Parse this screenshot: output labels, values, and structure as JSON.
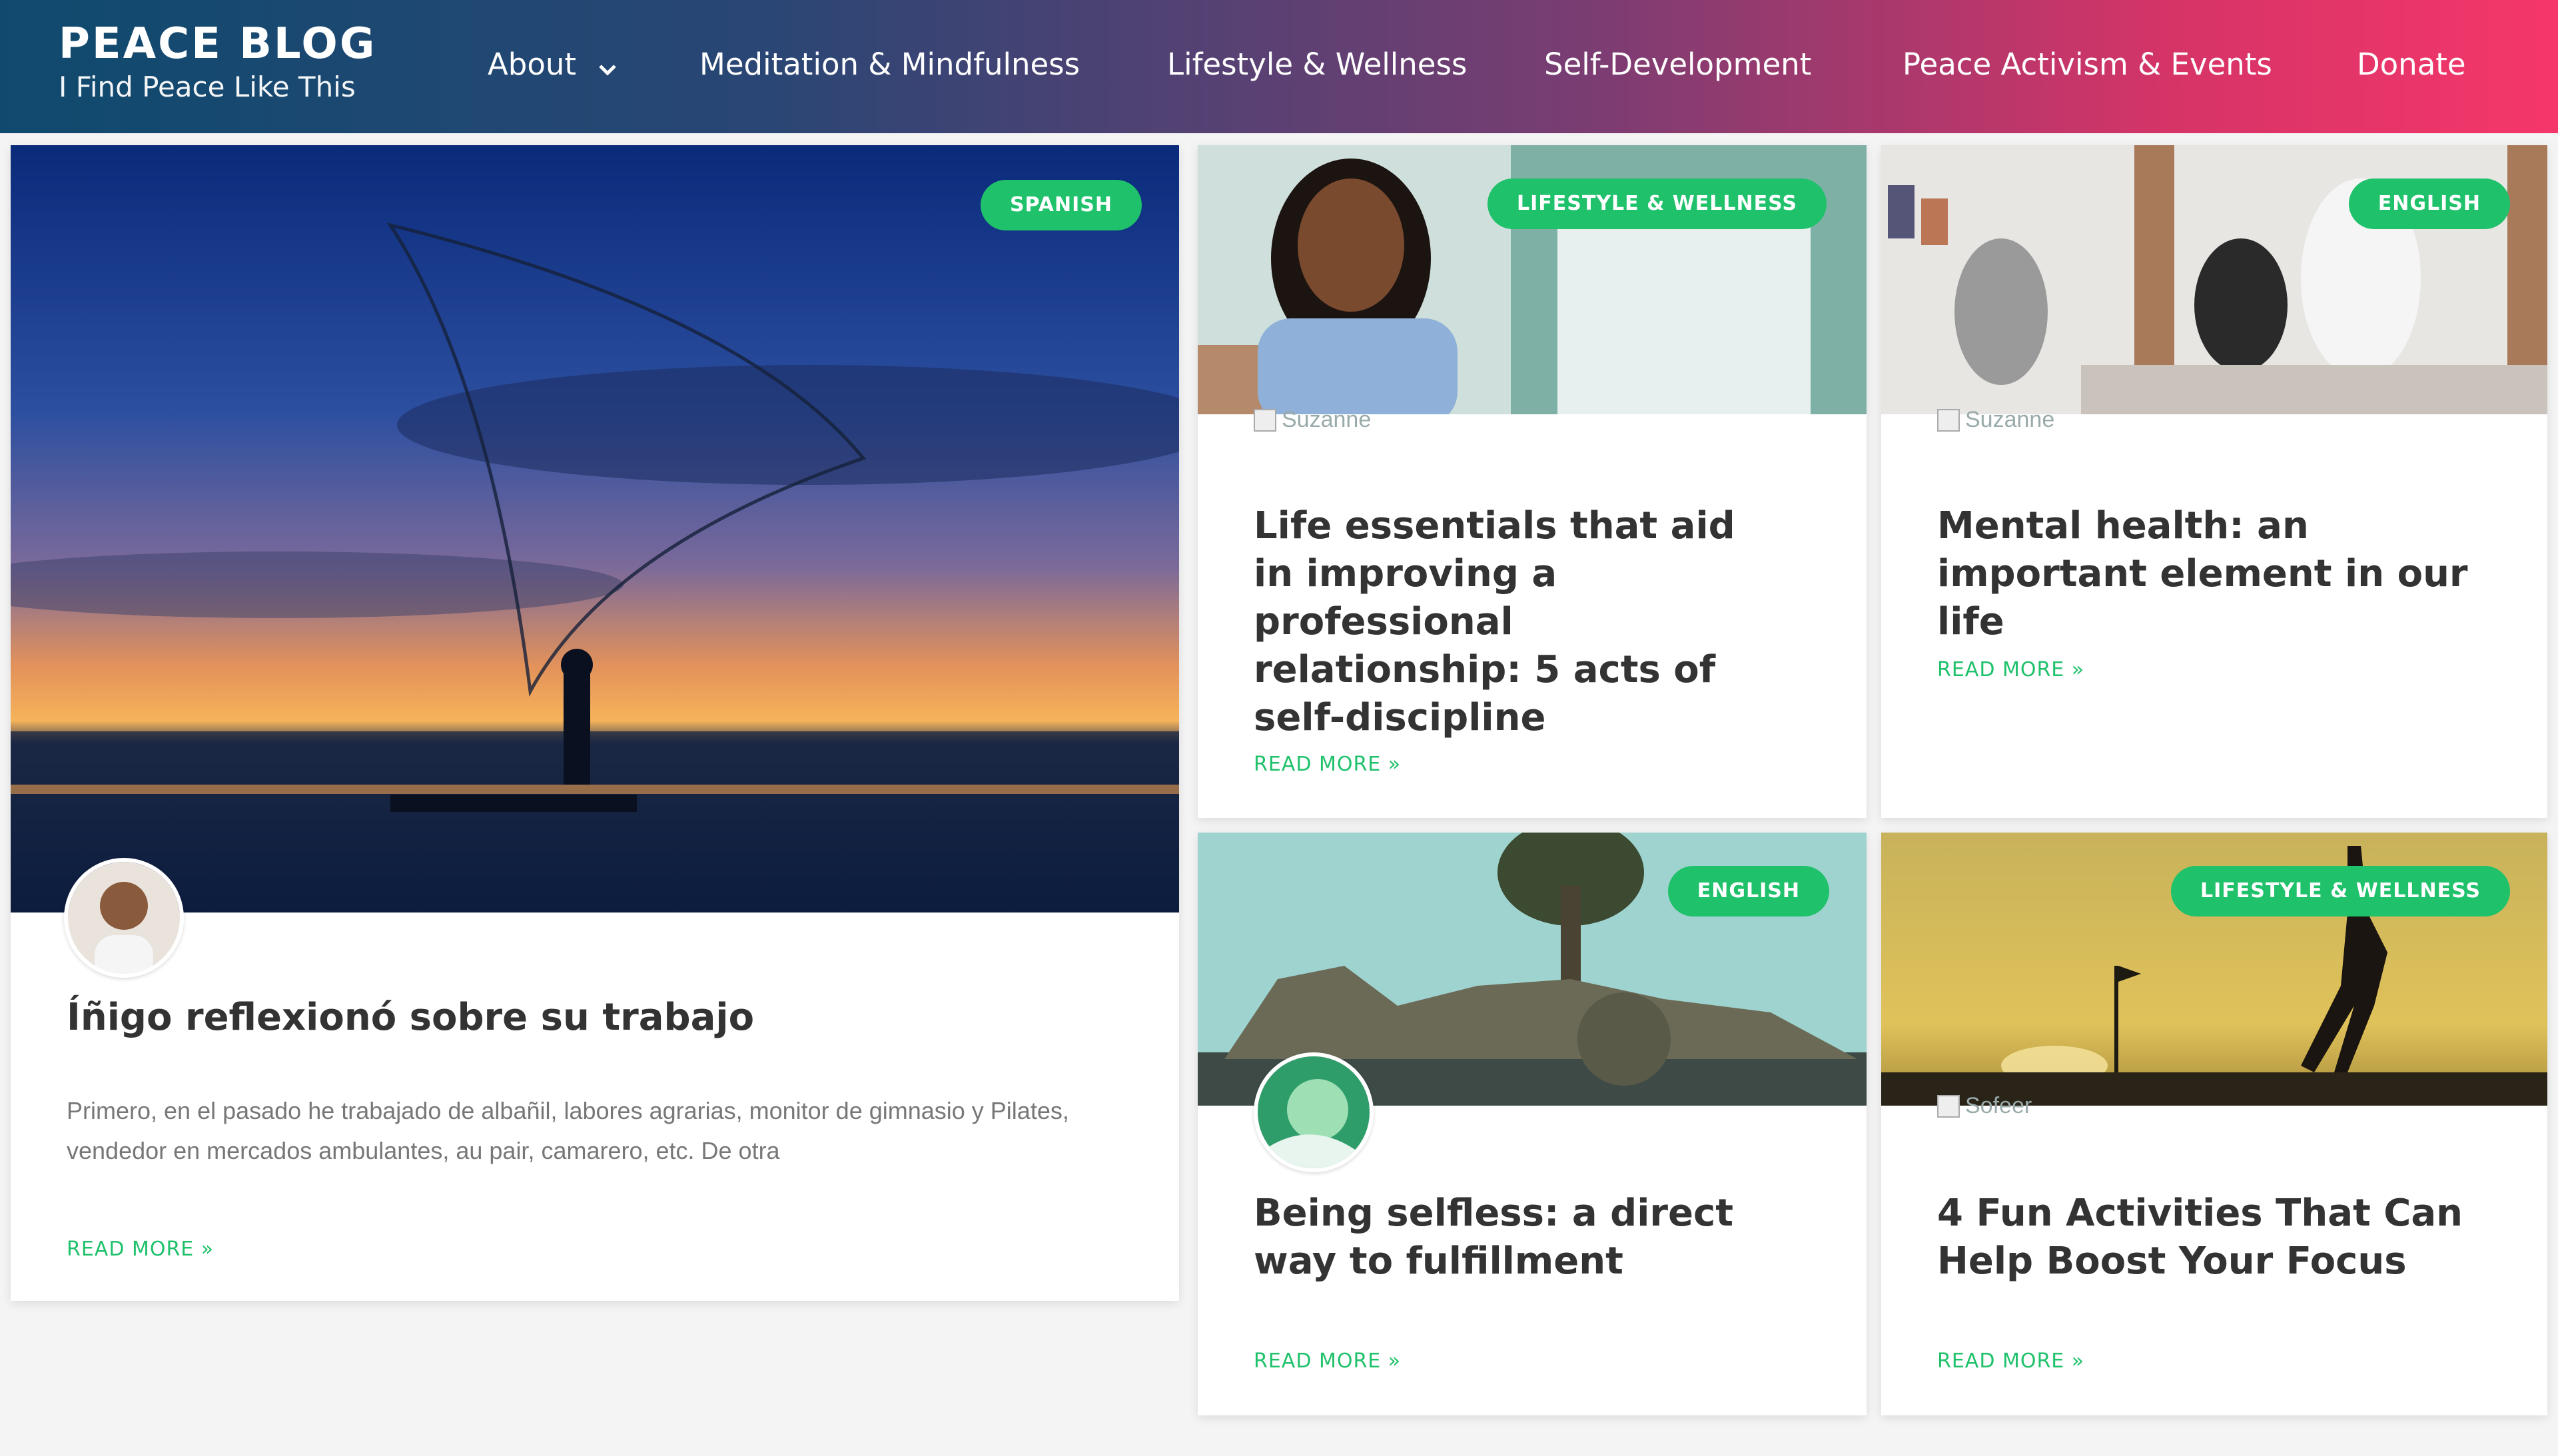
{
  "site": {
    "title": "PEACE BLOG",
    "tagline": "I Find Peace Like This"
  },
  "nav": {
    "items": [
      {
        "label": "About",
        "icon": "chevron-down-icon"
      },
      {
        "label": "Meditation & Mindfulness"
      },
      {
        "label": "Lifestyle & Wellness"
      },
      {
        "label": "Self-Development"
      },
      {
        "label": "Peace Activism & Events"
      },
      {
        "label": "Donate"
      }
    ]
  },
  "colors": {
    "accent": "#1fc16b",
    "header_start": "#0f4a6e",
    "header_end": "#f5366a"
  },
  "posts": [
    {
      "badge": "SPANISH",
      "title": "Íñigo reflexionó sobre su trabajo",
      "excerpt": "Primero, en el pasado he trabajado de albañil, labores agrarias, monitor de gimnasio y Pilates, vendedor en mercados ambulantes, au pair, camarero, etc. De otra",
      "read_more": "READ MORE »"
    },
    {
      "badge": "LIFESTYLE & WELLNESS",
      "author_alt": "Suzanne",
      "title": "Life essentials that aid in improving a professional relationship: 5 acts of self-discipline",
      "read_more": "READ MORE »"
    },
    {
      "badge": "ENGLISH",
      "author_alt": "Suzanne",
      "title": "Mental health: an important element in our life",
      "read_more": "READ MORE »"
    },
    {
      "badge": "ENGLISH",
      "title": "Being selfless: a direct way to fulfillment",
      "read_more": "READ MORE »"
    },
    {
      "badge": "LIFESTYLE & WELLNESS",
      "author_alt": "Sofeer",
      "title": "4 Fun Activities That Can Help Boost Your Focus",
      "read_more": "READ MORE »"
    }
  ]
}
